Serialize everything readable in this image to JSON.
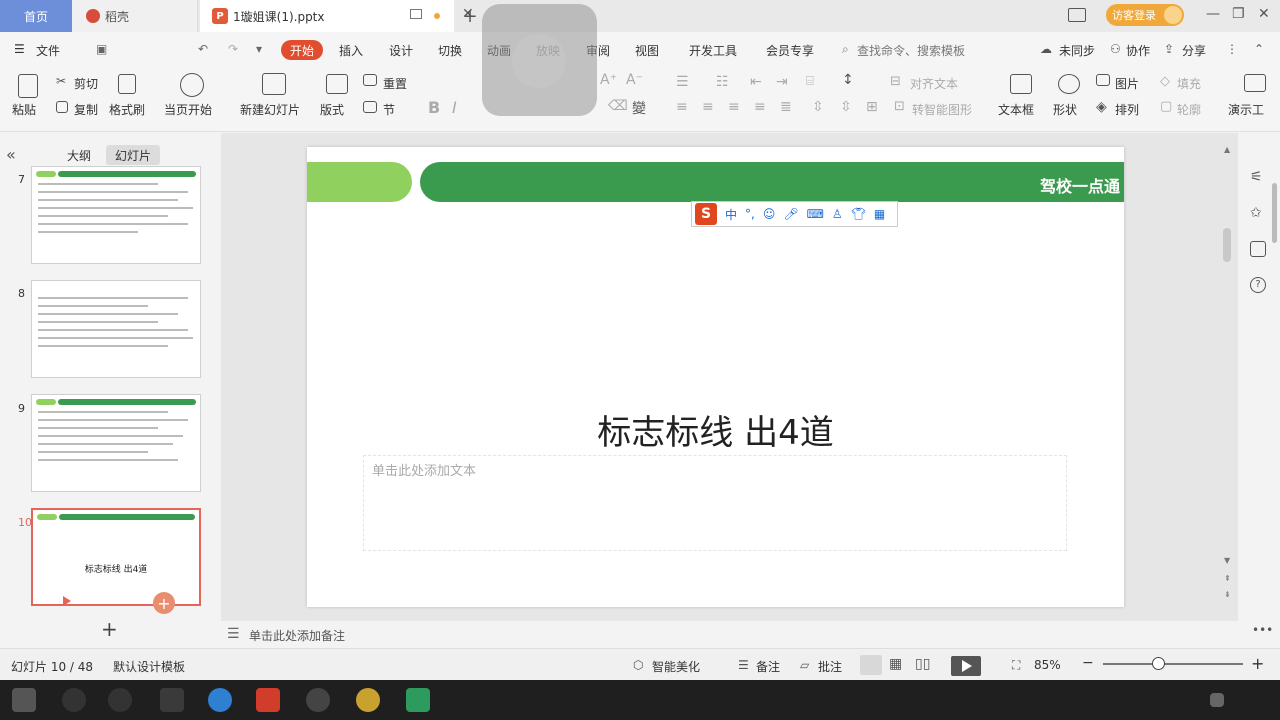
{
  "titlebar": {
    "tabs": [
      {
        "label": "首页"
      },
      {
        "label": "稻壳"
      },
      {
        "label": "1璇姐课(1).pptx"
      }
    ],
    "login_label": "访客登录"
  },
  "menubar": {
    "file": "文件",
    "items": [
      "开始",
      "插入",
      "设计",
      "切换",
      "动画",
      "放映",
      "审阅",
      "视图",
      "开发工具",
      "会员专享"
    ],
    "search_placeholder": "查找命令、搜索模板",
    "unsync": "未同步",
    "collab": "协作",
    "share": "分享"
  },
  "ribbon": {
    "paste": "粘贴",
    "cut": "剪切",
    "copy": "复制",
    "format_painter": "格式刷",
    "from_current": "当页开始",
    "new_slide": "新建幻灯片",
    "layout": "版式",
    "reset": "重置",
    "section": "节",
    "align_text": "对齐文本",
    "smart_art": "转智能图形",
    "textbox": "文本框",
    "shape": "形状",
    "picture": "图片",
    "arrange": "排列",
    "fill": "填充",
    "outline": "轮廓",
    "present": "演示工"
  },
  "leftpanel": {
    "outline_tab": "大纲",
    "slides_tab": "幻灯片",
    "slide_numbers": [
      "7",
      "8",
      "9",
      "10"
    ],
    "thumb10_title": "标志标线 出4道"
  },
  "slide": {
    "brand": "驾校一点通",
    "title": "标志标线 出4道",
    "subtitle_placeholder": "单击此处添加文本"
  },
  "ime": {
    "logo": "S",
    "mode": "中"
  },
  "notes": {
    "placeholder": "单击此处添加备注"
  },
  "statusbar": {
    "slide_counter": "幻灯片 10 / 48",
    "template": "默认设计模板",
    "beautify": "智能美化",
    "notes": "备注",
    "comments": "批注",
    "zoom": "85%"
  },
  "colors": {
    "accent_red": "#e04e2f",
    "home_tab": "#6d8fd9",
    "green_dark": "#3a9a4e",
    "green_light": "#8fd05f"
  }
}
